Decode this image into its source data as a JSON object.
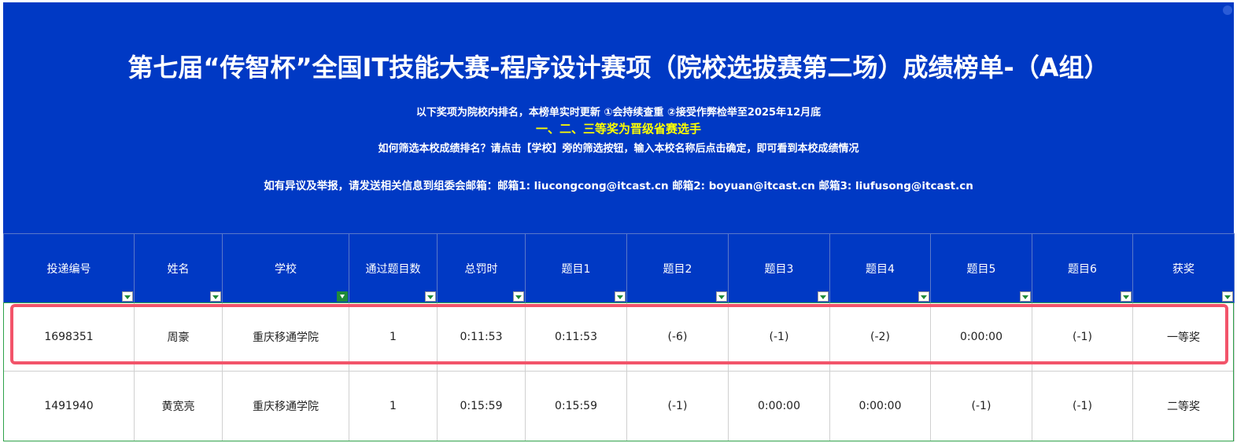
{
  "banner": {
    "title": "第七届“传智杯”全国IT技能大赛-程序设计赛项（院校选拔赛第二场）成绩榜单-（A组）",
    "line1": "以下奖项为院校内排名，本榜单实时更新 ①会持续查重 ②接受作弊检举至2025年12月底",
    "line2": "一、二、三等奖为晋级省赛选手",
    "line3": "如何筛选本校成绩排名？请点击【学校】旁的筛选按钮，输入本校名称后点击确定，即可看到本校成绩情况",
    "line4": "如有异议及举报，请发送相关信息到组委会邮箱：邮箱1: liucongcong@itcast.cn 邮箱2: boyuan@itcast.cn 邮箱3: liufusong@itcast.cn"
  },
  "columns": [
    "投递编号",
    "姓名",
    "学校",
    "通过题目数",
    "总罚时",
    "题目1",
    "题目2",
    "题目3",
    "题目4",
    "题目5",
    "题目6",
    "获奖"
  ],
  "rows": [
    [
      "1698351",
      "周豪",
      "重庆移通学院",
      "1",
      "0:11:53",
      "0:11:53",
      "(-6)",
      "(-1)",
      "(-2)",
      "0:00:00",
      "(-1)",
      "一等奖"
    ],
    [
      "1491940",
      "黄宽亮",
      "重庆移通学院",
      "1",
      "0:15:59",
      "0:15:59",
      "(-1)",
      "0:00:00",
      "0:00:00",
      "(-1)",
      "(-1)",
      "二等奖"
    ]
  ],
  "colors": {
    "header_bg": "#0039c4",
    "notice_yellow": "#ffff00",
    "highlight": "#f2546a",
    "filter_green": "#1f8a3a"
  }
}
